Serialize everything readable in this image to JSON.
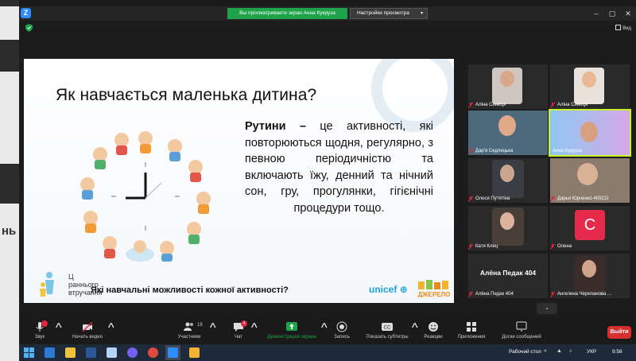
{
  "window": {
    "app_icon_letter": "Z",
    "share_banner": "Вы просматриваете экран Анна Кукруза",
    "view_settings": "Настройки просмотра",
    "view_toggle": "Вид"
  },
  "desktop": {
    "ghost_text": "нь"
  },
  "slide": {
    "title": "Як навчається маленька дитина?",
    "body_bold": "Рутини –",
    "body_text": " це активності, які повторюються щодня, регулярно, з певною періодичністю та включають їжу, денний та нічний сон, гру, прогулянки, гігієнічні процедури тощо.",
    "question": "Які навчальні можливості кожної активності?",
    "left_logo": "Ранньої втручання",
    "left_logo_line1": "Ц",
    "left_logo_line2": "раннього",
    "left_logo_line3": "втручання",
    "unicef": "unicef",
    "dzherelo": "ДЖЕРЕЛО"
  },
  "participants": [
    {
      "name": "Аліна Синиця",
      "muted": true
    },
    {
      "name": "Аліна Синиця",
      "muted": true
    },
    {
      "name": "Дар'я Седлецька",
      "muted": true
    },
    {
      "name": "Анна Кукруза",
      "muted": false,
      "active": true
    },
    {
      "name": "Олеся Путятіна",
      "muted": true
    },
    {
      "name": "Дарья Юрченко 405СО",
      "muted": true
    },
    {
      "name": "Катя Клец",
      "muted": true
    },
    {
      "name": "Олена",
      "muted": true,
      "avatar_letter": "С"
    },
    {
      "name": "Алёна Педак 404",
      "muted": true,
      "big_name": "Алёна Педак 404"
    },
    {
      "name": "Ангелина Черепанова ...",
      "muted": true
    }
  ],
  "toolbar": {
    "audio": "Звук",
    "video": "Начать видео",
    "participants": "Участники",
    "participants_count": "18",
    "chat": "Чат",
    "chat_badge": "4",
    "share": "Демонстрация экрана",
    "record": "Запись",
    "subtitles": "Показать субтитры",
    "reactions": "Реакции",
    "apps": "Приложения",
    "whiteboard": "Доски сообщений",
    "leave": "Выйти"
  },
  "taskbar": {
    "desktop_label": "Рабочий стол",
    "lang": "УКР",
    "time": "9:58"
  },
  "colors": {
    "share_green": "#1fa34a",
    "active_border": "#c8f229",
    "leave_red": "#d72f2f",
    "muted_red": "#e0263c",
    "zoom_blue": "#2d8cff"
  }
}
